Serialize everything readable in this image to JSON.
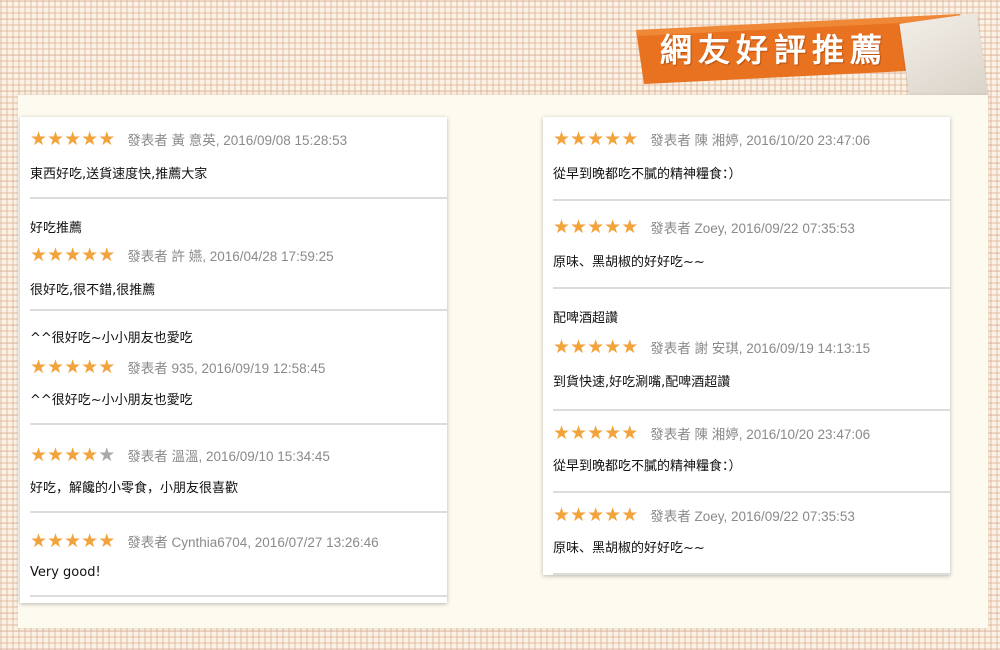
{
  "banner": {
    "title": "網友好評推薦"
  },
  "colors": {
    "star": "#f2a33c",
    "star_empty": "#a9a9a9",
    "banner": "#e8721f"
  },
  "icons": {
    "star": "star-icon",
    "star_empty": "star-empty-icon"
  },
  "left_reviews": [
    {
      "title": "",
      "rating": 5,
      "author": "發表者 黃 意英, 2016/09/08 15:28:53",
      "text": "東西好吃,送貨速度快,推薦大家"
    },
    {
      "title": "好吃推薦",
      "rating": 5,
      "author": "發表者 許 嬿, 2016/04/28 17:59:25",
      "text": "很好吃,很不錯,很推薦"
    },
    {
      "title": "^^很好吃~小小朋友也愛吃",
      "rating": 5,
      "author": "發表者 935, 2016/09/19 12:58:45",
      "text": "^^很好吃~小小朋友也愛吃"
    },
    {
      "title": "",
      "rating": 4,
      "author": "發表者 溫溫, 2016/09/10 15:34:45",
      "text": "好吃，解饞的小零食，小朋友很喜歡"
    },
    {
      "title": "",
      "rating": 5,
      "author": "發表者 Cynthia6704, 2016/07/27 13:26:46",
      "text": "Very good!"
    }
  ],
  "right_reviews": [
    {
      "title": "",
      "rating": 5,
      "author": "發表者 陳 湘婷, 2016/10/20 23:47:06",
      "text": "從早到晚都吃不膩的精神糧食：）"
    },
    {
      "title": "",
      "rating": 5,
      "author": "發表者 Zoey, 2016/09/22 07:35:53",
      "text": "原味、黑胡椒的好好吃~~"
    },
    {
      "title": "配啤酒超讚",
      "rating": 5,
      "author": "發表者 謝 安琪, 2016/09/19 14:13:15",
      "text": "到貨快速,好吃涮嘴,配啤酒超讚"
    },
    {
      "title": "",
      "rating": 5,
      "author": "發表者 陳 湘婷, 2016/10/20 23:47:06",
      "text": "從早到晚都吃不膩的精神糧食：）"
    },
    {
      "title": "",
      "rating": 5,
      "author": "發表者 Zoey, 2016/09/22 07:35:53",
      "text": "原味、黑胡椒的好好吃~~"
    }
  ]
}
